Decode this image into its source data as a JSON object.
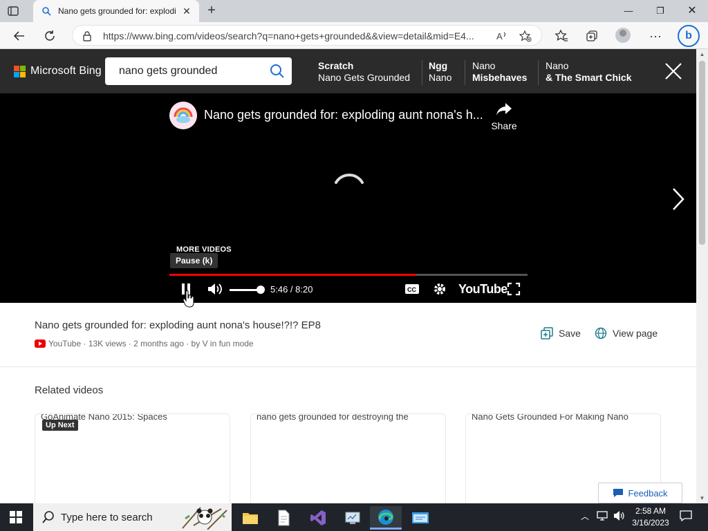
{
  "browser": {
    "tab_title": "Nano gets grounded for: explodi",
    "tab_close_icon": "close-icon",
    "url": "https://www.bing.com/videos/search?q=nano+gets+grounded&&view=detail&mid=E4...",
    "window_controls": [
      "minimize-icon",
      "restore-icon",
      "close-icon"
    ]
  },
  "bing": {
    "brand": "Microsoft Bing",
    "search_query": "nano gets grounded",
    "related_searches": [
      {
        "line1": "Scratch",
        "line2": "Nano Gets Grounded"
      },
      {
        "line1": "Ngg",
        "line2": "Nano"
      },
      {
        "line1": "Nano",
        "line2": "Misbehaves"
      },
      {
        "line1": "Nano",
        "line2": "& The Smart Chick"
      }
    ]
  },
  "player": {
    "title": "Nano gets grounded for: exploding aunt nona's h...",
    "share_label": "Share",
    "more_videos": "MORE VIDEOS",
    "tooltip": "Pause (k)",
    "time": "5:46 / 8:20",
    "progress_fraction": 0.69,
    "volume_fraction": 0.8,
    "brand": "YouTube",
    "accent_color": "#ff0000"
  },
  "info": {
    "title": "Nano gets grounded for: exploding aunt nona's house!?!? EP8",
    "meta": "YouTube · 13K views · 2 months ago · by V in fun mode",
    "save_label": "Save",
    "view_page_label": "View page"
  },
  "related": {
    "heading": "Related videos",
    "up_next": "Up Next",
    "cards": [
      {
        "alt": "GoAnimate Nano 2015: Spaces"
      },
      {
        "alt": "nano gets grounded for destroying the"
      },
      {
        "alt": "Nano Gets Grounded For Making Nano"
      }
    ]
  },
  "feedback_label": "Feedback",
  "taskbar": {
    "search_placeholder": "Type here to search",
    "time": "2:58 AM",
    "date": "3/16/2023"
  }
}
